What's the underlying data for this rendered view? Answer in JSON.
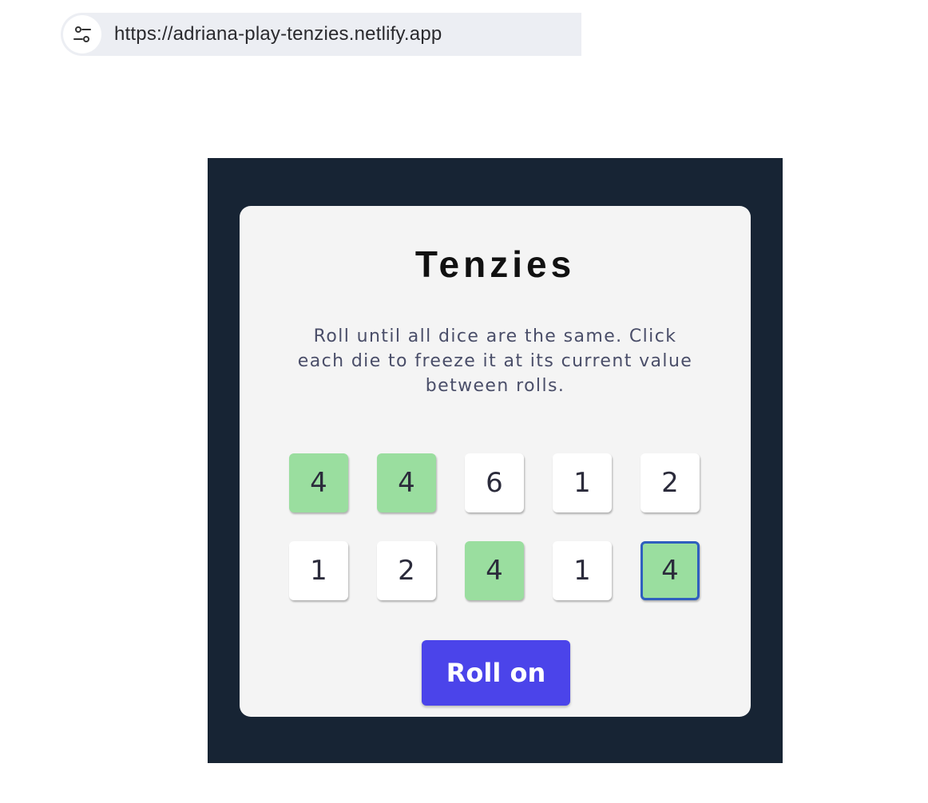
{
  "browser": {
    "url": "https://adriana-play-tenzies.netlify.app",
    "site_info_icon": "sliders-icon"
  },
  "game": {
    "title": "Tenzies",
    "instructions": "Roll until all dice are the same. Click each die to freeze it at its current value between rolls.",
    "dice": [
      {
        "value": "4",
        "held": true
      },
      {
        "value": "4",
        "held": true
      },
      {
        "value": "6",
        "held": false
      },
      {
        "value": "1",
        "held": false
      },
      {
        "value": "2",
        "held": false
      },
      {
        "value": "1",
        "held": false
      },
      {
        "value": "2",
        "held": false
      },
      {
        "value": "4",
        "held": true
      },
      {
        "value": "1",
        "held": false
      },
      {
        "value": "4",
        "held": true,
        "focused": true
      }
    ],
    "roll_button_label": "Roll on"
  },
  "colors": {
    "frame_background": "#172434",
    "card_background": "#f4f4f4",
    "held_die": "#9ade9f",
    "die": "#ffffff",
    "button": "#4b44ea",
    "focus_outline": "#2f5fbf"
  }
}
